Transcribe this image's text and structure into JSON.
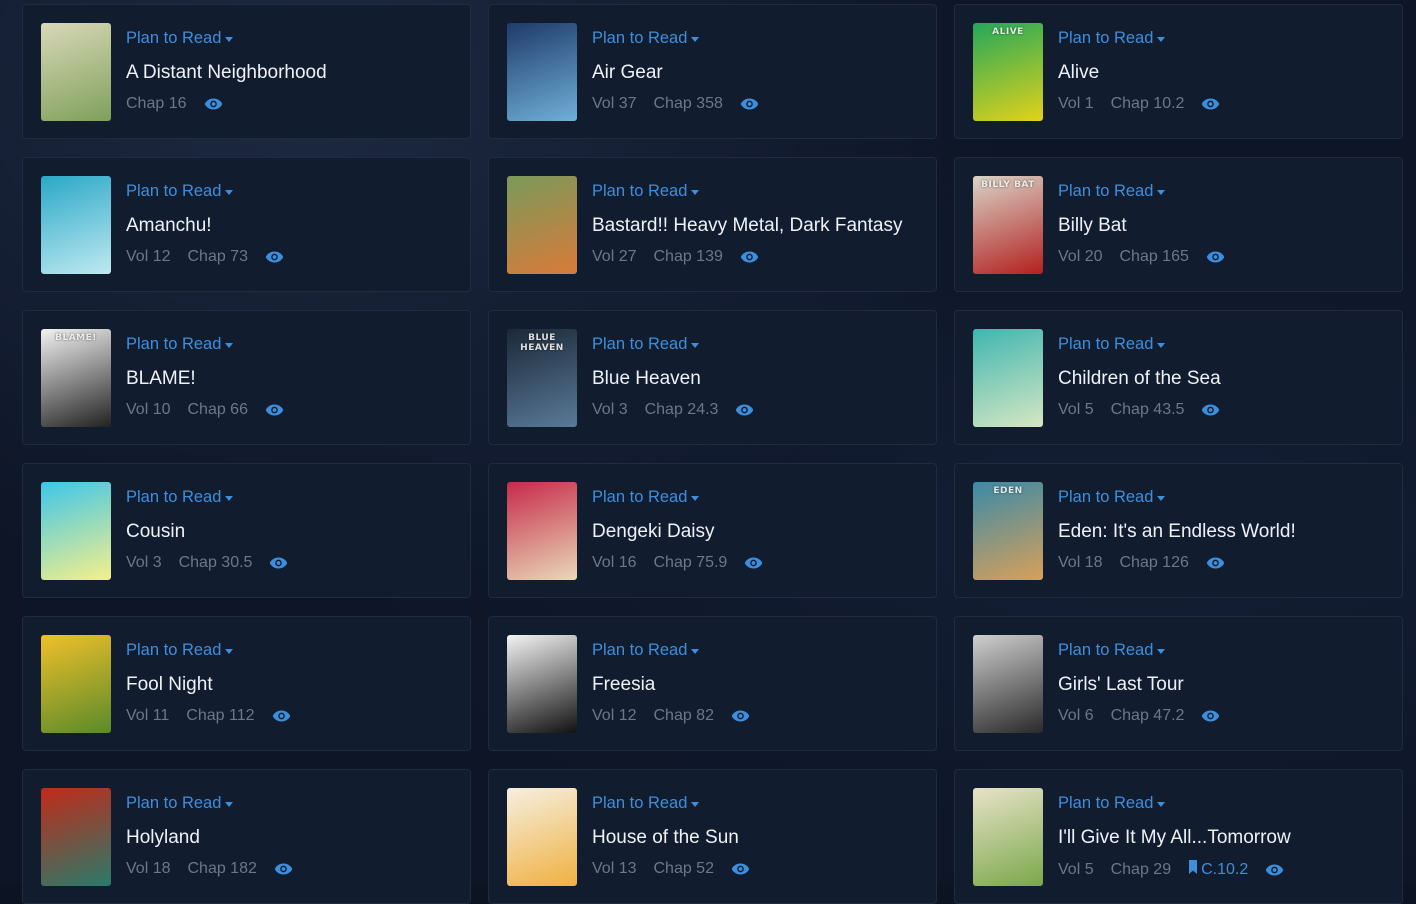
{
  "colors": {
    "accent": "#3d8fdd",
    "card_bg": "#121c2f",
    "page_bg": "#0d1526",
    "title_text": "#eef2f8",
    "meta_text": "#6c7789"
  },
  "cards": [
    {
      "status": "Plan to Read",
      "title": "A Distant Neighborhood",
      "vol": "",
      "chap": "Chap 16",
      "bookmark": "",
      "cover_colors": [
        "#d9d8b8",
        "#7fa05a"
      ],
      "cover_text": ""
    },
    {
      "status": "Plan to Read",
      "title": "Air Gear",
      "vol": "Vol 37",
      "chap": "Chap 358",
      "bookmark": "",
      "cover_colors": [
        "#1f3a6a",
        "#6fb0d8"
      ],
      "cover_text": ""
    },
    {
      "status": "Plan to Read",
      "title": "Alive",
      "vol": "Vol 1",
      "chap": "Chap 10.2",
      "bookmark": "",
      "cover_colors": [
        "#23a85a",
        "#e2d21b"
      ],
      "cover_text": "ALIVE"
    },
    {
      "status": "Plan to Read",
      "title": "Amanchu!",
      "vol": "Vol 12",
      "chap": "Chap 73",
      "bookmark": "",
      "cover_colors": [
        "#2aa8c7",
        "#bfe9f1"
      ],
      "cover_text": ""
    },
    {
      "status": "Plan to Read",
      "title": "Bastard!! Heavy Metal, Dark Fantasy",
      "vol": "Vol 27",
      "chap": "Chap 139",
      "bookmark": "",
      "cover_colors": [
        "#7a9a5a",
        "#d97a3a"
      ],
      "cover_text": ""
    },
    {
      "status": "Plan to Read",
      "title": "Billy Bat",
      "vol": "Vol 20",
      "chap": "Chap 165",
      "bookmark": "",
      "cover_colors": [
        "#d9d4c8",
        "#b3201f"
      ],
      "cover_text": "BILLY BAT"
    },
    {
      "status": "Plan to Read",
      "title": "BLAME!",
      "vol": "Vol 10",
      "chap": "Chap 66",
      "bookmark": "",
      "cover_colors": [
        "#f2f2f2",
        "#222222"
      ],
      "cover_text": "BLAME!"
    },
    {
      "status": "Plan to Read",
      "title": "Blue Heaven",
      "vol": "Vol 3",
      "chap": "Chap 24.3",
      "bookmark": "",
      "cover_colors": [
        "#1b2838",
        "#5a7a98"
      ],
      "cover_text": "BLUE HEAVEN"
    },
    {
      "status": "Plan to Read",
      "title": "Children of the Sea",
      "vol": "Vol 5",
      "chap": "Chap 43.5",
      "bookmark": "",
      "cover_colors": [
        "#3fb6b0",
        "#d6e7c2"
      ],
      "cover_text": ""
    },
    {
      "status": "Plan to Read",
      "title": "Cousin",
      "vol": "Vol 3",
      "chap": "Chap 30.5",
      "bookmark": "",
      "cover_colors": [
        "#3ec6ea",
        "#f6f08a"
      ],
      "cover_text": ""
    },
    {
      "status": "Plan to Read",
      "title": "Dengeki Daisy",
      "vol": "Vol 16",
      "chap": "Chap 75.9",
      "bookmark": "",
      "cover_colors": [
        "#c72a4a",
        "#e9d9b8"
      ],
      "cover_text": ""
    },
    {
      "status": "Plan to Read",
      "title": "Eden: It's an Endless World!",
      "vol": "Vol 18",
      "chap": "Chap 126",
      "bookmark": "",
      "cover_colors": [
        "#3a8aa8",
        "#d8a05a"
      ],
      "cover_text": "EDEN"
    },
    {
      "status": "Plan to Read",
      "title": "Fool Night",
      "vol": "Vol 11",
      "chap": "Chap 112",
      "bookmark": "",
      "cover_colors": [
        "#f0c02a",
        "#5a8a2a"
      ],
      "cover_text": ""
    },
    {
      "status": "Plan to Read",
      "title": "Freesia",
      "vol": "Vol 12",
      "chap": "Chap 82",
      "bookmark": "",
      "cover_colors": [
        "#f4f4f4",
        "#111111"
      ],
      "cover_text": ""
    },
    {
      "status": "Plan to Read",
      "title": "Girls' Last Tour",
      "vol": "Vol 6",
      "chap": "Chap 47.2",
      "bookmark": "",
      "cover_colors": [
        "#cfcfcf",
        "#2a2a2a"
      ],
      "cover_text": ""
    },
    {
      "status": "Plan to Read",
      "title": "Holyland",
      "vol": "Vol 18",
      "chap": "Chap 182",
      "bookmark": "",
      "cover_colors": [
        "#c22a1a",
        "#2a7a6a"
      ],
      "cover_text": ""
    },
    {
      "status": "Plan to Read",
      "title": "House of the Sun",
      "vol": "Vol 13",
      "chap": "Chap 52",
      "bookmark": "",
      "cover_colors": [
        "#f6efe0",
        "#f0b040"
      ],
      "cover_text": ""
    },
    {
      "status": "Plan to Read",
      "title": "I'll Give It My All...Tomorrow",
      "vol": "Vol 5",
      "chap": "Chap 29",
      "bookmark": "C.10.2",
      "cover_colors": [
        "#e8e2c8",
        "#7aa84a"
      ],
      "cover_text": ""
    }
  ]
}
